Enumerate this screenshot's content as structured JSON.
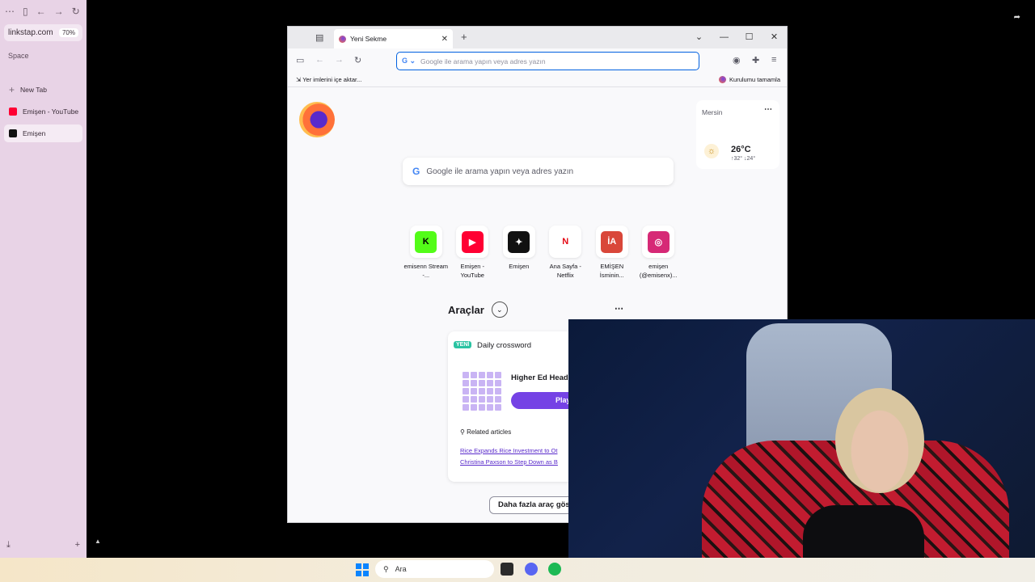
{
  "arc_sidebar": {
    "url": "linkstap.com",
    "zoom": "70%",
    "space_label": "Space",
    "items": [
      {
        "label": "New Tab",
        "color": "#8a7a88"
      },
      {
        "label": "Emişen - YouTube",
        "color": "#ff0033"
      },
      {
        "label": "Emişen",
        "color": "#111111"
      }
    ]
  },
  "firefox": {
    "tab_title": "Yeni Sekme",
    "url_placeholder": "Google ile arama yapın veya adres yazın",
    "bookmark_import": "Yer imlerini içe aktar...",
    "bookmark_right": "Kurulumu tamamla",
    "weather": {
      "city": "Mersin",
      "temp": "26°C",
      "high_low": "↑32° ↓24°"
    },
    "search_placeholder": "Google ile arama yapın veya adres yazın",
    "shortcuts": [
      {
        "label": "emisenn Stream -...",
        "icon": "kick-icon",
        "glyph": "K",
        "bg": "#53fc18",
        "fg": "#000000"
      },
      {
        "label": "Emişen - YouTube",
        "icon": "youtube-icon",
        "glyph": "▶",
        "bg": "#ff0033",
        "fg": "#ffffff"
      },
      {
        "label": "Emişen",
        "icon": "linkstap-icon",
        "glyph": "✦",
        "bg": "#111111",
        "fg": "#ffffff"
      },
      {
        "label": "Ana Sayfa - Netflix",
        "icon": "netflix-icon",
        "glyph": "N",
        "bg": "#ffffff",
        "fg": "#e50914"
      },
      {
        "label": "EMİŞEN İsminin...",
        "icon": "ia-icon",
        "glyph": "İA",
        "bg": "#d9473a",
        "fg": "#ffffff"
      },
      {
        "label": "emişen (@emisenx)...",
        "icon": "instagram-icon",
        "glyph": "◎",
        "bg": "#d62976",
        "fg": "#ffffff"
      }
    ],
    "tools_title": "Araçlar",
    "card": {
      "badge": "YENİ",
      "title": "Daily crossword",
      "puzzle": "Higher Ed Head",
      "play": "Play",
      "related": "Related articles",
      "articles": [
        "Rice Expands Rice Investment to Ot",
        "Christina Paxson to Step Down as B"
      ]
    },
    "more_tools": "Daha fazla araç gös"
  },
  "taskbar": {
    "search": "Ara"
  }
}
